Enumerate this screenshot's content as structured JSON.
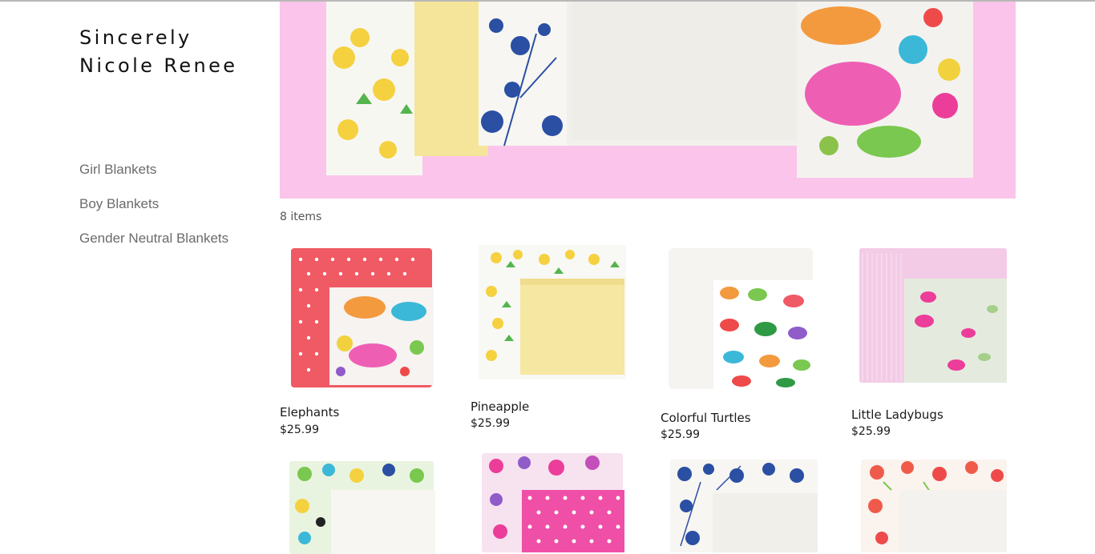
{
  "site": {
    "brand_line1": "Sincerely",
    "brand_line2": "Nicole Renee"
  },
  "nav": {
    "items": [
      {
        "label": "Girl Blankets"
      },
      {
        "label": "Boy Blankets"
      },
      {
        "label": "Gender Neutral Blankets"
      }
    ]
  },
  "hero": {
    "background_color": "#fbc4ea"
  },
  "catalog": {
    "item_count": "8 items",
    "products": [
      {
        "name": "Elephants",
        "price": "$25.99"
      },
      {
        "name": "Pineapple",
        "price": "$25.99"
      },
      {
        "name": "Colorful Turtles",
        "price": "$25.99"
      },
      {
        "name": "Little Ladybugs",
        "price": "$25.99"
      },
      {
        "name": "",
        "price": ""
      },
      {
        "name": "",
        "price": ""
      },
      {
        "name": "",
        "price": ""
      },
      {
        "name": "",
        "price": ""
      }
    ]
  },
  "colors": {
    "nav_text": "#6b6b6b",
    "hero_pink": "#fbc4ea",
    "coral": "#f05a64",
    "butter_yellow": "#f6e7a2",
    "flannel_white": "#f4f2ee",
    "light_pink": "#f3cbe6",
    "hot_pink": "#ec3d9a",
    "indigo_floral": "#2a4fa3"
  }
}
